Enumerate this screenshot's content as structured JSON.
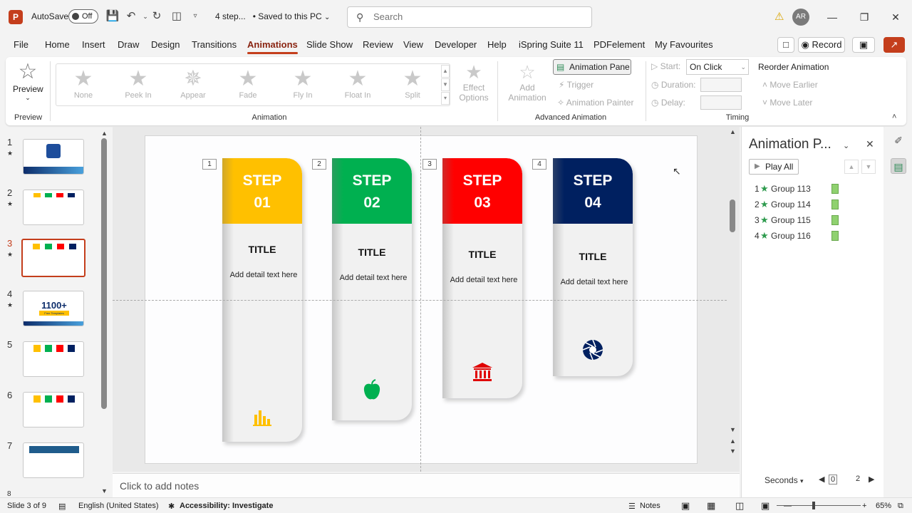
{
  "titlebar": {
    "app_letter": "P",
    "autosave_label": "AutoSave",
    "autosave_state": "Off",
    "doc_name": "4 step...",
    "save_status": "• Saved to this PC",
    "search_placeholder": "Search",
    "user_initials": "AR"
  },
  "tabs": [
    "File",
    "Home",
    "Insert",
    "Draw",
    "Design",
    "Transitions",
    "Animations",
    "Slide Show",
    "Review",
    "View",
    "Developer",
    "Help",
    "iSpring Suite 11",
    "PDFelement",
    "My Favourites"
  ],
  "active_tab": "Animations",
  "record_label": "Record",
  "ribbon": {
    "preview_label": "Preview",
    "preview_group": "Preview",
    "animations": [
      "None",
      "Peek In",
      "Appear",
      "Fade",
      "Fly In",
      "Float In",
      "Split"
    ],
    "animation_group": "Animation",
    "effect_options_1": "Effect",
    "effect_options_2": "Options",
    "add_animation_1": "Add",
    "add_animation_2": "Animation",
    "animation_pane_btn": "Animation Pane",
    "trigger_label": "Trigger",
    "animation_painter": "Animation Painter",
    "advanced_group": "Advanced Animation",
    "start_label": "Start:",
    "start_value": "On Click",
    "duration_label": "Duration:",
    "delay_label": "Delay:",
    "reorder_label": "Reorder Animation",
    "move_earlier": "Move Earlier",
    "move_later": "Move Later",
    "timing_group": "Timing"
  },
  "thumbnails": [
    {
      "num": "1",
      "star": "★"
    },
    {
      "num": "2",
      "star": "★"
    },
    {
      "num": "3",
      "star": "★"
    },
    {
      "num": "4",
      "star": "★"
    },
    {
      "num": "5",
      "star": ""
    },
    {
      "num": "6",
      "star": ""
    },
    {
      "num": "7",
      "star": ""
    },
    {
      "num": "8",
      "star": ""
    }
  ],
  "thumb4_text": "1100+",
  "thumb4_sub": "Free Templates",
  "slide": {
    "cards": [
      {
        "tag": "1",
        "step": "STEP",
        "num": "01",
        "title": "TITLE",
        "detail": "Add detail text here",
        "color": "#FFC000",
        "icon": "bar-chart-icon"
      },
      {
        "tag": "2",
        "step": "STEP",
        "num": "02",
        "title": "TITLE",
        "detail": "Add detail text here",
        "color": "#00B050",
        "icon": "apple-icon"
      },
      {
        "tag": "3",
        "step": "STEP",
        "num": "03",
        "title": "TITLE",
        "detail": "Add detail text here",
        "color": "#FF0000",
        "icon": "bank-icon"
      },
      {
        "tag": "4",
        "step": "STEP",
        "num": "04",
        "title": "TITLE",
        "detail": "Add detail text here",
        "color": "#002060",
        "icon": "shutter-icon"
      }
    ]
  },
  "notes_placeholder": "Click to add notes",
  "anim_pane": {
    "title": "Animation P...",
    "play_all": "Play All",
    "items": [
      {
        "num": "1",
        "name": "Group 113"
      },
      {
        "num": "2",
        "name": "Group 114"
      },
      {
        "num": "3",
        "name": "Group 115"
      },
      {
        "num": "4",
        "name": "Group 116"
      }
    ],
    "seconds_label": "Seconds",
    "timeline_start": "0",
    "timeline_end": "2"
  },
  "status": {
    "slide_info": "Slide 3 of 9",
    "language": "English (United States)",
    "accessibility": "Accessibility: Investigate",
    "notes": "Notes",
    "zoom": "65%"
  }
}
